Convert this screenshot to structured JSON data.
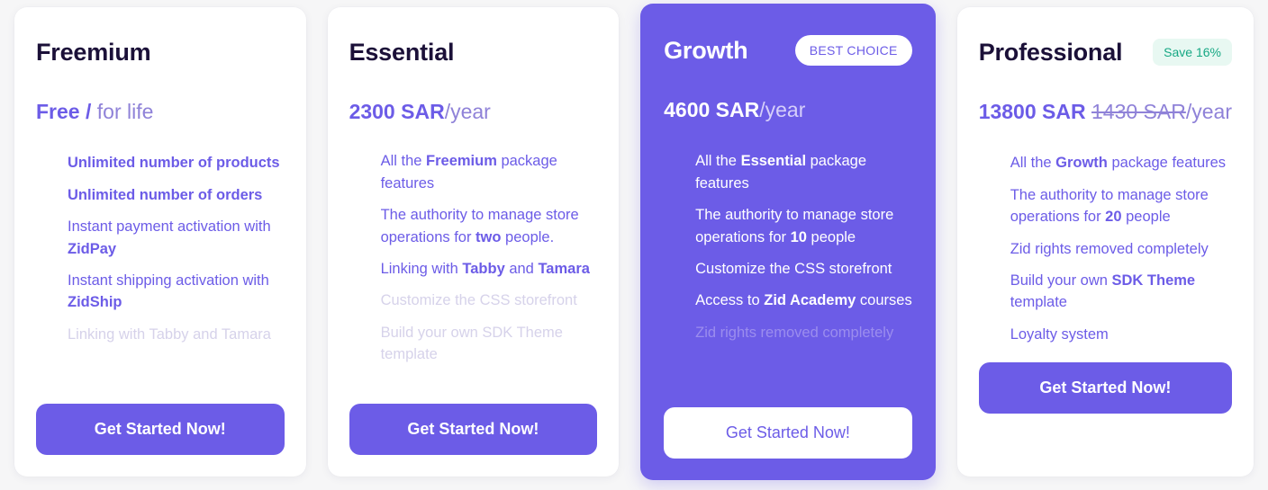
{
  "theme": {
    "accent": "#6c5ce7",
    "page_background": "#f6f6f7",
    "card_background": "#ffffff",
    "muted_text": "#d6d2ea",
    "save_badge_text": "#16a884",
    "save_badge_background": "#e8f8f2"
  },
  "plans": [
    {
      "name": "Freemium",
      "badge": null,
      "price_main": "Free /",
      "price_old": null,
      "price_period": " for life",
      "cta_label": "Get Started Now!",
      "features": [
        {
          "parts": [
            {
              "text": "Unlimited number of products",
              "bold": true
            }
          ],
          "muted": false,
          "all_bold": true
        },
        {
          "parts": [
            {
              "text": "Unlimited number of orders",
              "bold": true
            }
          ],
          "muted": false,
          "all_bold": true
        },
        {
          "parts": [
            {
              "text": "Instant payment activation with ",
              "bold": false
            },
            {
              "text": "ZidPay",
              "bold": true
            }
          ],
          "muted": false,
          "all_bold": false
        },
        {
          "parts": [
            {
              "text": "Instant shipping activation with ",
              "bold": false
            },
            {
              "text": "ZidShip",
              "bold": true
            }
          ],
          "muted": false,
          "all_bold": false
        },
        {
          "parts": [
            {
              "text": "Linking with Tabby and Tamara",
              "bold": false
            }
          ],
          "muted": true,
          "all_bold": false
        }
      ]
    },
    {
      "name": "Essential",
      "badge": null,
      "price_main": "2300 SAR",
      "price_old": null,
      "price_period": "/year",
      "cta_label": "Get Started Now!",
      "features": [
        {
          "parts": [
            {
              "text": "All the ",
              "bold": false
            },
            {
              "text": "Freemium",
              "bold": true
            },
            {
              "text": " package features",
              "bold": false
            }
          ],
          "muted": false,
          "all_bold": false
        },
        {
          "parts": [
            {
              "text": "The authority to manage store operations for ",
              "bold": false
            },
            {
              "text": "two",
              "bold": true
            },
            {
              "text": " people.",
              "bold": false
            }
          ],
          "muted": false,
          "all_bold": false
        },
        {
          "parts": [
            {
              "text": "Linking with ",
              "bold": false
            },
            {
              "text": "Tabby",
              "bold": true
            },
            {
              "text": " and ",
              "bold": false
            },
            {
              "text": "Tamara",
              "bold": true
            }
          ],
          "muted": false,
          "all_bold": false
        },
        {
          "parts": [
            {
              "text": "Customize the CSS storefront",
              "bold": false
            }
          ],
          "muted": true,
          "all_bold": false
        },
        {
          "parts": [
            {
              "text": "Build your own SDK Theme template",
              "bold": false
            }
          ],
          "muted": true,
          "all_bold": false
        }
      ]
    },
    {
      "name": "Growth",
      "badge": {
        "label": "BEST CHOICE",
        "kind": "best"
      },
      "price_main": "4600 SAR",
      "price_old": null,
      "price_period": "/year",
      "cta_label": "Get Started Now!",
      "features": [
        {
          "parts": [
            {
              "text": "All the ",
              "bold": false
            },
            {
              "text": "Essential",
              "bold": true
            },
            {
              "text": " package features",
              "bold": false
            }
          ],
          "muted": false,
          "all_bold": false
        },
        {
          "parts": [
            {
              "text": "The authority to manage store operations for ",
              "bold": false
            },
            {
              "text": "10",
              "bold": true
            },
            {
              "text": " people",
              "bold": false
            }
          ],
          "muted": false,
          "all_bold": false
        },
        {
          "parts": [
            {
              "text": "Customize the CSS storefront",
              "bold": false
            }
          ],
          "muted": false,
          "all_bold": false
        },
        {
          "parts": [
            {
              "text": "Access to ",
              "bold": false
            },
            {
              "text": "Zid Academy",
              "bold": true
            },
            {
              "text": " courses",
              "bold": false
            }
          ],
          "muted": false,
          "all_bold": false
        },
        {
          "parts": [
            {
              "text": "Zid rights removed completely",
              "bold": false
            }
          ],
          "muted": true,
          "all_bold": false
        }
      ]
    },
    {
      "name": "Professional",
      "badge": {
        "label": "Save 16%",
        "kind": "save"
      },
      "price_main": "13800 SAR",
      "price_old": "1430 SAR",
      "price_period": "/year",
      "cta_label": "Get Started Now!",
      "features": [
        {
          "parts": [
            {
              "text": "All the ",
              "bold": false
            },
            {
              "text": "Growth",
              "bold": true
            },
            {
              "text": " package features",
              "bold": false
            }
          ],
          "muted": false,
          "all_bold": false
        },
        {
          "parts": [
            {
              "text": "The authority to manage store operations for ",
              "bold": false
            },
            {
              "text": "20",
              "bold": true
            },
            {
              "text": " people",
              "bold": false
            }
          ],
          "muted": false,
          "all_bold": false
        },
        {
          "parts": [
            {
              "text": "Zid rights removed completely",
              "bold": false
            }
          ],
          "muted": false,
          "all_bold": false
        },
        {
          "parts": [
            {
              "text": "Build your own ",
              "bold": false
            },
            {
              "text": "SDK Theme",
              "bold": true
            },
            {
              "text": " template",
              "bold": false
            }
          ],
          "muted": false,
          "all_bold": false
        },
        {
          "parts": [
            {
              "text": "Loyalty system",
              "bold": false
            }
          ],
          "muted": false,
          "all_bold": false
        }
      ]
    }
  ]
}
